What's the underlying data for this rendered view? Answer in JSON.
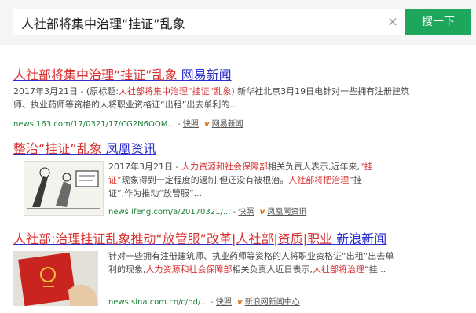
{
  "search": {
    "query": "人社部将集中治理“挂证”乱象",
    "clear_icon": "×",
    "button": "搜一下"
  },
  "results": [
    {
      "title_parts": [
        "人社部将集中治理“挂证”乱象",
        " 网易新闻"
      ],
      "snippet_parts": [
        "2017年3月21日 - (原标题:",
        "人社部将集中治理“挂证”乱象",
        ") 新华社北京3月19日电针对一些拥有注册建筑师、执业药师等资格的人将职业资格证“出租”出去单利的..."
      ],
      "url": "news.163.com/17/0321/17/CG2N6OQM...",
      "cache": "快照",
      "source": "网易新闻"
    },
    {
      "title_parts": [
        "整治“挂证”乱象",
        " 凤凰资讯"
      ],
      "snippet_parts": [
        "2017年3月21日 - ",
        "人力资源和社会保障部",
        "相关负责人表示,近年来,",
        "“挂证”",
        "现象得到一定程度的遏制,但还没有被根治。",
        "人社部将把治理",
        "“挂证”,作为推动“放管服”..."
      ],
      "url": "news.ifeng.com/a/20170321/...",
      "cache": "快照",
      "source": "凤凰网资讯"
    },
    {
      "title_parts": [
        "人社部:治理挂证乱象推动“放管服”改革|人社部|资质|职业",
        " 新浪新闻"
      ],
      "snippet_parts": [
        "针对一些拥有注册建筑师、执业药师等资格的人将职业资格证“出租”出去单利的现象,",
        "人力资源和社会保障部",
        "相关负责人近日表示,",
        "人社部将治理",
        "“挂..."
      ],
      "url": "news.sina.com.cn/c/nd/...",
      "cache": "快照",
      "source": "新浪网新闻中心"
    }
  ],
  "icons": {
    "clear": "close-icon",
    "version": "v-icon"
  },
  "colors": {
    "accent": "#1fa65d",
    "title": "#2b2ecf",
    "highlight": "#d83131",
    "url": "#1a7f37"
  }
}
